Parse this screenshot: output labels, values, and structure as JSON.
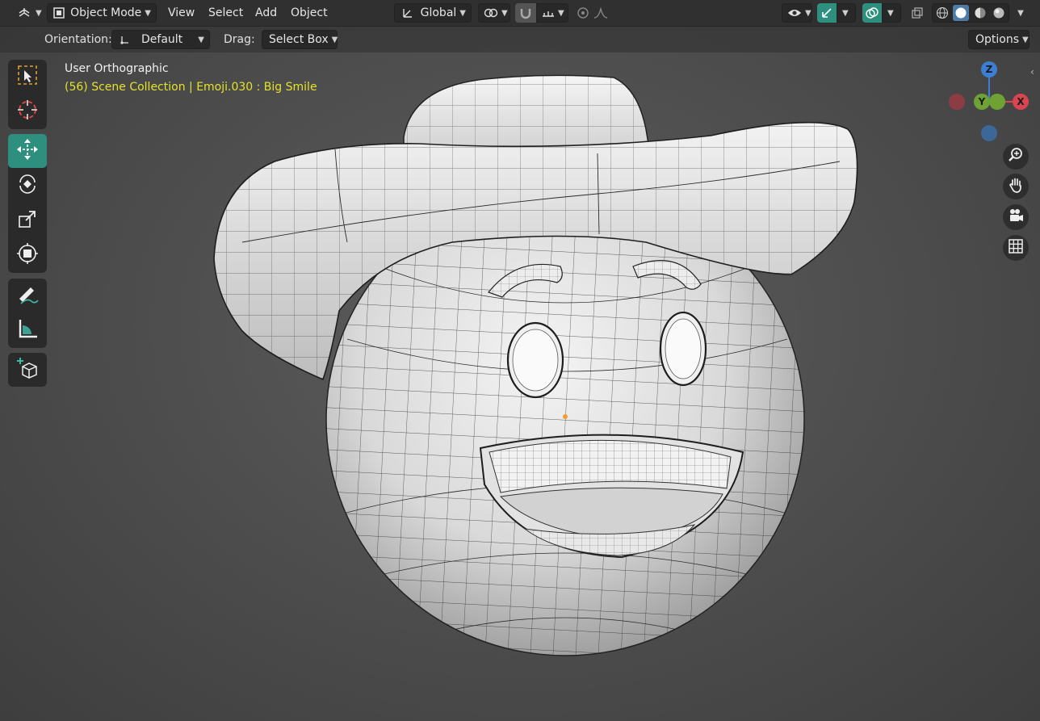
{
  "header": {
    "editor_type_icon": "3d-viewport-icon",
    "mode": {
      "icon": "object-mode-icon",
      "label": "Object Mode"
    },
    "menus": [
      "View",
      "Select",
      "Add",
      "Object"
    ],
    "transform_orientation": {
      "icon": "orientation-axes-icon",
      "label": "Global"
    },
    "pivot_icon": "pivot-point-icon",
    "snap_icon": "magnet-icon",
    "snap_target_icon": "snap-increment-icon",
    "proportional_icon": "proportional-edit-icon",
    "falloff_icon": "falloff-curve-icon",
    "visibility_icon": "eye-icon",
    "gizmo_icon": "gizmo-icon",
    "overlay_icon": "overlays-icon",
    "xray_icon": "xray-icon",
    "shading_modes": [
      "wireframe",
      "solid",
      "material-preview",
      "rendered"
    ],
    "active_shading": "solid"
  },
  "tool_settings": {
    "orientation_label": "Orientation:",
    "orientation_value": "Default",
    "drag_label": "Drag:",
    "drag_value": "Select Box",
    "options_label": "Options"
  },
  "toolbar": {
    "tools": [
      {
        "name": "select-box",
        "icon": "select-box-icon"
      },
      {
        "name": "cursor",
        "icon": "cursor-icon"
      },
      {
        "name": "move",
        "icon": "move-icon",
        "active": true
      },
      {
        "name": "rotate",
        "icon": "rotate-icon"
      },
      {
        "name": "scale",
        "icon": "scale-icon"
      },
      {
        "name": "transform",
        "icon": "transform-icon"
      },
      {
        "name": "annotate",
        "icon": "annotate-icon"
      },
      {
        "name": "measure",
        "icon": "measure-icon"
      },
      {
        "name": "add-cube",
        "icon": "add-cube-icon"
      }
    ]
  },
  "viewport": {
    "view_name": "User Orthographic",
    "scene_info": "(56) Scene Collection | Emoji.030 : Big Smile"
  },
  "gizmo": {
    "axes": [
      {
        "label": "Z",
        "color": "#3b7fd4"
      },
      {
        "label": "Y",
        "color": "#6ea234"
      },
      {
        "label": "X",
        "color": "#d9454f"
      }
    ],
    "nav_buttons": [
      "zoom-icon",
      "hand-pan-icon",
      "camera-icon",
      "grid-perspective-icon"
    ]
  },
  "colors": {
    "accent": "#2f8f7f",
    "header_bg": "#303030",
    "scene_info_text": "#e5e22a"
  }
}
